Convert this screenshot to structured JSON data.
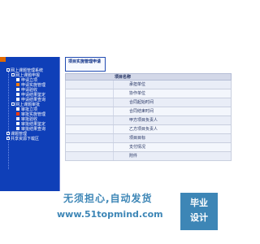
{
  "tree": {
    "items": [
      {
        "label": "网上课题管理系统",
        "level": 1,
        "marker": "box"
      },
      {
        "label": "网上课题申报",
        "level": 2,
        "marker": "box"
      },
      {
        "label": "申请立项",
        "level": 3,
        "marker": "blue"
      },
      {
        "label": "申请实施管理",
        "level": 3,
        "marker": "orange"
      },
      {
        "label": "申请验收",
        "level": 3,
        "marker": "blue"
      },
      {
        "label": "申请结果鉴定",
        "level": 3,
        "marker": "blue"
      },
      {
        "label": "申请结果查询",
        "level": 3,
        "marker": "blue"
      },
      {
        "label": "网上课题审批",
        "level": 2,
        "marker": "box"
      },
      {
        "label": "审批立项",
        "level": 3,
        "marker": "blue"
      },
      {
        "label": "审批实施管理",
        "level": 3,
        "marker": "red"
      },
      {
        "label": "审批验收",
        "level": 3,
        "marker": "white"
      },
      {
        "label": "审批结果鉴定",
        "level": 3,
        "marker": "blue"
      },
      {
        "label": "审批结果查询",
        "level": 3,
        "marker": "blue"
      },
      {
        "label": "课题管理",
        "level": 1,
        "marker": "box"
      },
      {
        "label": "共享资源下载区",
        "level": 1,
        "marker": "box"
      }
    ]
  },
  "content": {
    "tab_label": "项目实施管理申请",
    "table_header": "项目名称",
    "rows": [
      "承担单位",
      "协作单位",
      "合同起始时间",
      "合同结束时间",
      "甲方项目负责人",
      "乙方项目负责人",
      "项目目标",
      "支付情况",
      "附件"
    ]
  },
  "watermark": {
    "line1": "无须担心,自动发货",
    "line2": "www.51topmind.com",
    "badge_line1": "毕业",
    "badge_line2": "设计"
  }
}
